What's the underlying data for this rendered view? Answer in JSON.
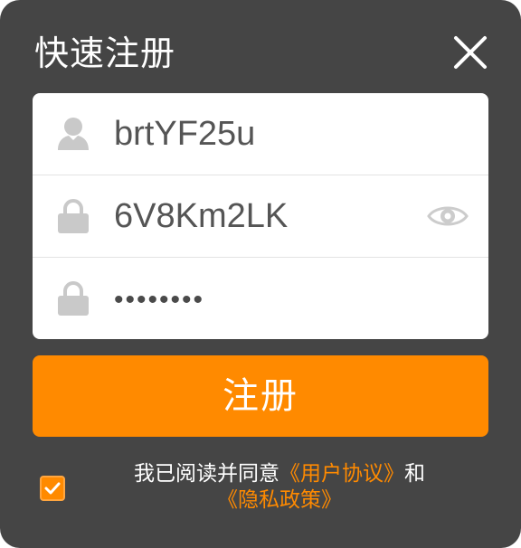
{
  "dialog": {
    "title": "快速注册"
  },
  "form": {
    "username_value": "brtYF25u",
    "password_value": "6V8Km2LK",
    "confirm_password_display": "••••••••"
  },
  "register_button": {
    "label": "注册"
  },
  "agreement": {
    "checked": true,
    "prefix": "我已阅读并同意",
    "user_agreement_link": "《用户协议》",
    "conjunction": "和",
    "privacy_link": "《隐私政策》"
  },
  "colors": {
    "background": "#454545",
    "accent": "#ff8a00",
    "input_bg": "#ffffff"
  },
  "icons": {
    "close": "close-icon",
    "user": "user-icon",
    "lock": "lock-icon",
    "eye": "eye-icon",
    "check": "checkmark-icon"
  }
}
